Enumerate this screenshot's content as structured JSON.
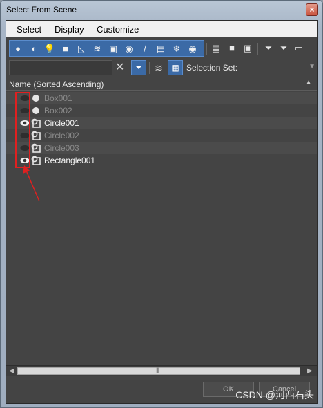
{
  "window": {
    "title": "Select From Scene"
  },
  "menu": [
    "Select",
    "Display",
    "Customize"
  ],
  "toolbar": {
    "type_filters": [
      {
        "icon": "geometry-icon",
        "glyph": "●"
      },
      {
        "icon": "shapes-icon",
        "glyph": "◐"
      },
      {
        "icon": "lights-icon",
        "glyph": "💡"
      },
      {
        "icon": "cameras-icon",
        "glyph": "■"
      },
      {
        "icon": "helpers-icon",
        "glyph": "◺"
      },
      {
        "icon": "spacewarps-icon",
        "glyph": "≋"
      },
      {
        "icon": "groups-icon",
        "glyph": "▣"
      },
      {
        "icon": "xrefs-icon",
        "glyph": "◉"
      },
      {
        "icon": "bones-icon",
        "glyph": "/"
      },
      {
        "icon": "containers-icon",
        "glyph": "▤"
      },
      {
        "icon": "frozen-icon",
        "glyph": "❄"
      },
      {
        "icon": "hidden-icon",
        "glyph": "◉"
      }
    ],
    "extra_buttons": [
      {
        "icon": "select-all-icon",
        "glyph": "▤"
      },
      {
        "icon": "select-none-icon",
        "glyph": "■"
      },
      {
        "icon": "select-invert-icon",
        "glyph": "▣"
      },
      {
        "icon": "filter-options-icon",
        "glyph": "⏷"
      },
      {
        "icon": "filter-icon",
        "glyph": "⏷"
      },
      {
        "icon": "container-icon",
        "glyph": "▭"
      }
    ]
  },
  "search": {
    "value": "",
    "clear_glyph": "✕"
  },
  "toolbar2": {
    "filter_glyph": "⏷",
    "layer_glyph": "≋",
    "hier_glyph": "▦",
    "selection_set_label": "Selection Set:"
  },
  "list": {
    "header": "Name (Sorted Ascending)",
    "sort_glyph": "▲",
    "items": [
      {
        "name": "Box001",
        "visible": false,
        "type": "geometry"
      },
      {
        "name": "Box002",
        "visible": false,
        "type": "geometry"
      },
      {
        "name": "Circle001",
        "visible": true,
        "type": "shape"
      },
      {
        "name": "Circle002",
        "visible": false,
        "type": "shape"
      },
      {
        "name": "Circle003",
        "visible": false,
        "type": "shape"
      },
      {
        "name": "Rectangle001",
        "visible": true,
        "type": "shape"
      }
    ]
  },
  "scrollbar": {
    "left": "◀",
    "right": "▶",
    "grip": "|||"
  },
  "buttons": {
    "ok": "OK",
    "cancel": "Cancel"
  },
  "watermark": "CSDN @河西石头",
  "colors": {
    "accent": "#3b6aa6",
    "annotation": "#e02020",
    "panel": "#444444"
  }
}
